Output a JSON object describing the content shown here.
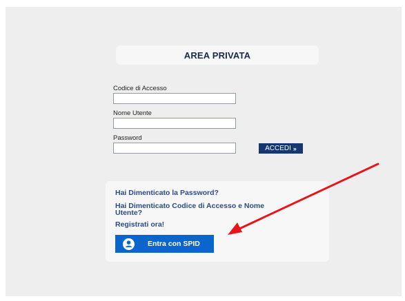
{
  "header": {
    "title": "AREA PRIVATA"
  },
  "form": {
    "access_code_label": "Codice di Accesso",
    "access_code_value": "",
    "username_label": "Nome Utente",
    "username_value": "",
    "password_label": "Password",
    "password_value": "",
    "submit_label": "ACCEDI",
    "submit_chevron": "»"
  },
  "help": {
    "forgot_password": "Hai Dimenticato la Password?",
    "forgot_code_line1": "Hai Dimenticato Codice di Accesso e Nome",
    "forgot_code_line2": "Utente?",
    "register": "Registrati ora!"
  },
  "spid": {
    "label": "Entra con SPID",
    "icon": "user-icon"
  },
  "annotation": {
    "arrow_color": "#e8141a",
    "button_color": "#0a66cc",
    "accedi_color": "#143672"
  }
}
